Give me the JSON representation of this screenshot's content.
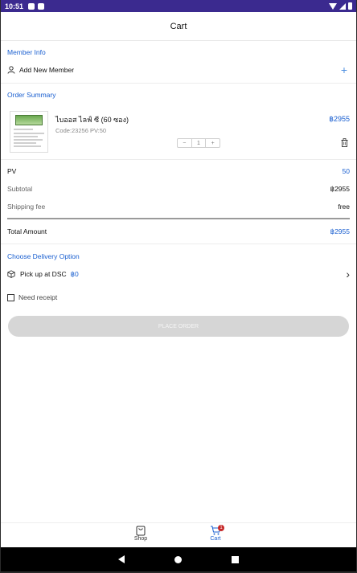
{
  "status_bar": {
    "time": "10:51"
  },
  "app_bar": {
    "title": "Cart"
  },
  "member": {
    "section_title": "Member Info",
    "add_label": "Add New Member",
    "add_icon": "+"
  },
  "order": {
    "section_title": "Order Summary",
    "product": {
      "name": "ไบออส ไลฟ์ ซี (60 ซอง)",
      "code": "Code:23256 PV:50",
      "price": "฿2955",
      "qty_minus": "−",
      "qty": "1",
      "qty_plus": "+"
    }
  },
  "summary": {
    "pv_label": "PV",
    "pv_value": "50",
    "subtotal_label": "Subtotal",
    "subtotal_value": "฿2955",
    "shipping_label": "Shipping fee",
    "shipping_value": "free",
    "total_label": "Total Amount",
    "total_value": "฿2955"
  },
  "delivery": {
    "section_title": "Choose Delivery Option",
    "pickup_label": "Pick up at DSC",
    "pickup_price": "฿0",
    "chevron": "›"
  },
  "receipt": {
    "label": "Need receipt",
    "checked": false
  },
  "place_order": {
    "label": "PLACE ORDER",
    "enabled": false
  },
  "bottom_nav": {
    "shop_label": "Shop",
    "cart_label": "Cart",
    "cart_badge": "1",
    "active": "Cart"
  },
  "colors": {
    "accent": "#1a5fd0",
    "status_bar": "#3b2a8f",
    "badge": "#c62828",
    "button_disabled": "#d6d6d6"
  }
}
